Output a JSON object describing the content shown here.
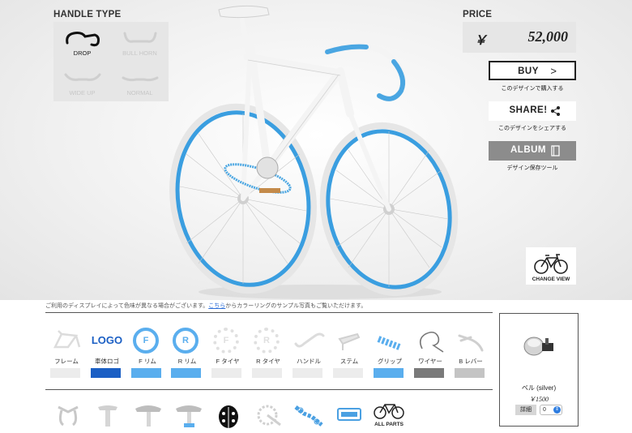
{
  "handle_type": {
    "title": "HANDLE TYPE",
    "options": [
      {
        "label": "DROP",
        "selected": true
      },
      {
        "label": "BULL HORN",
        "selected": false
      },
      {
        "label": "WIDE UP",
        "selected": false
      },
      {
        "label": "NORMAL",
        "selected": false
      }
    ]
  },
  "price": {
    "title": "PRICE",
    "currency": "￥",
    "value": "52,000"
  },
  "actions": {
    "buy_label": "BUY",
    "buy_sub": "このデザインで購入する",
    "share_label": "SHARE!",
    "share_sub": "このデザインをシェアする",
    "album_label": "ALBUM",
    "album_sub": "デザイン保存ツール"
  },
  "change_view_label": "CHANGE VIEW",
  "notice": {
    "before": "ご利用のディスプレイによって色味が異なる場合がございます。",
    "link": "こちら",
    "after": "からカラーリングのサンプル写真もご覧いただけます。"
  },
  "parts": [
    {
      "label": "フレーム",
      "color": "#ececec",
      "icon": "frame-icon"
    },
    {
      "label": "車体ロゴ",
      "color": "#1b5fc4",
      "icon": "logo-icon",
      "icon_text": "LOGO"
    },
    {
      "label": "F リム",
      "color": "#5aaeee",
      "icon": "front-rim-icon",
      "icon_text": "F"
    },
    {
      "label": "R リム",
      "color": "#5aaeee",
      "icon": "rear-rim-icon",
      "icon_text": "R"
    },
    {
      "label": "F タイヤ",
      "color": "#ececec",
      "icon": "front-tire-icon",
      "icon_text": "F"
    },
    {
      "label": "R タイヤ",
      "color": "#ececec",
      "icon": "rear-tire-icon",
      "icon_text": "R"
    },
    {
      "label": "ハンドル",
      "color": "#ececec",
      "icon": "handlebar-icon"
    },
    {
      "label": "ステム",
      "color": "#ececec",
      "icon": "stem-icon"
    },
    {
      "label": "グリップ",
      "color": "#5aaeee",
      "icon": "grip-icon"
    },
    {
      "label": "ワイヤー",
      "color": "#7a7a7a",
      "icon": "wire-icon"
    },
    {
      "label": "B レバー",
      "color": "#c4c4c4",
      "icon": "brake-lever-icon"
    }
  ],
  "tools": [
    {
      "icon": "brake-caliper-icon"
    },
    {
      "icon": "seatpost-icon"
    },
    {
      "icon": "saddle-icon"
    },
    {
      "icon": "saddle-blue-icon"
    },
    {
      "icon": "ladybug-bell-icon"
    },
    {
      "icon": "crankset-icon"
    },
    {
      "icon": "chain-icon"
    },
    {
      "icon": "pedal-icon"
    },
    {
      "icon": "all-parts-icon",
      "label": "ALL PARTS"
    }
  ],
  "cart": {
    "item_name": "ベル (silver)",
    "item_price": "￥1500",
    "detail_label": "詳細",
    "qty": "0"
  }
}
